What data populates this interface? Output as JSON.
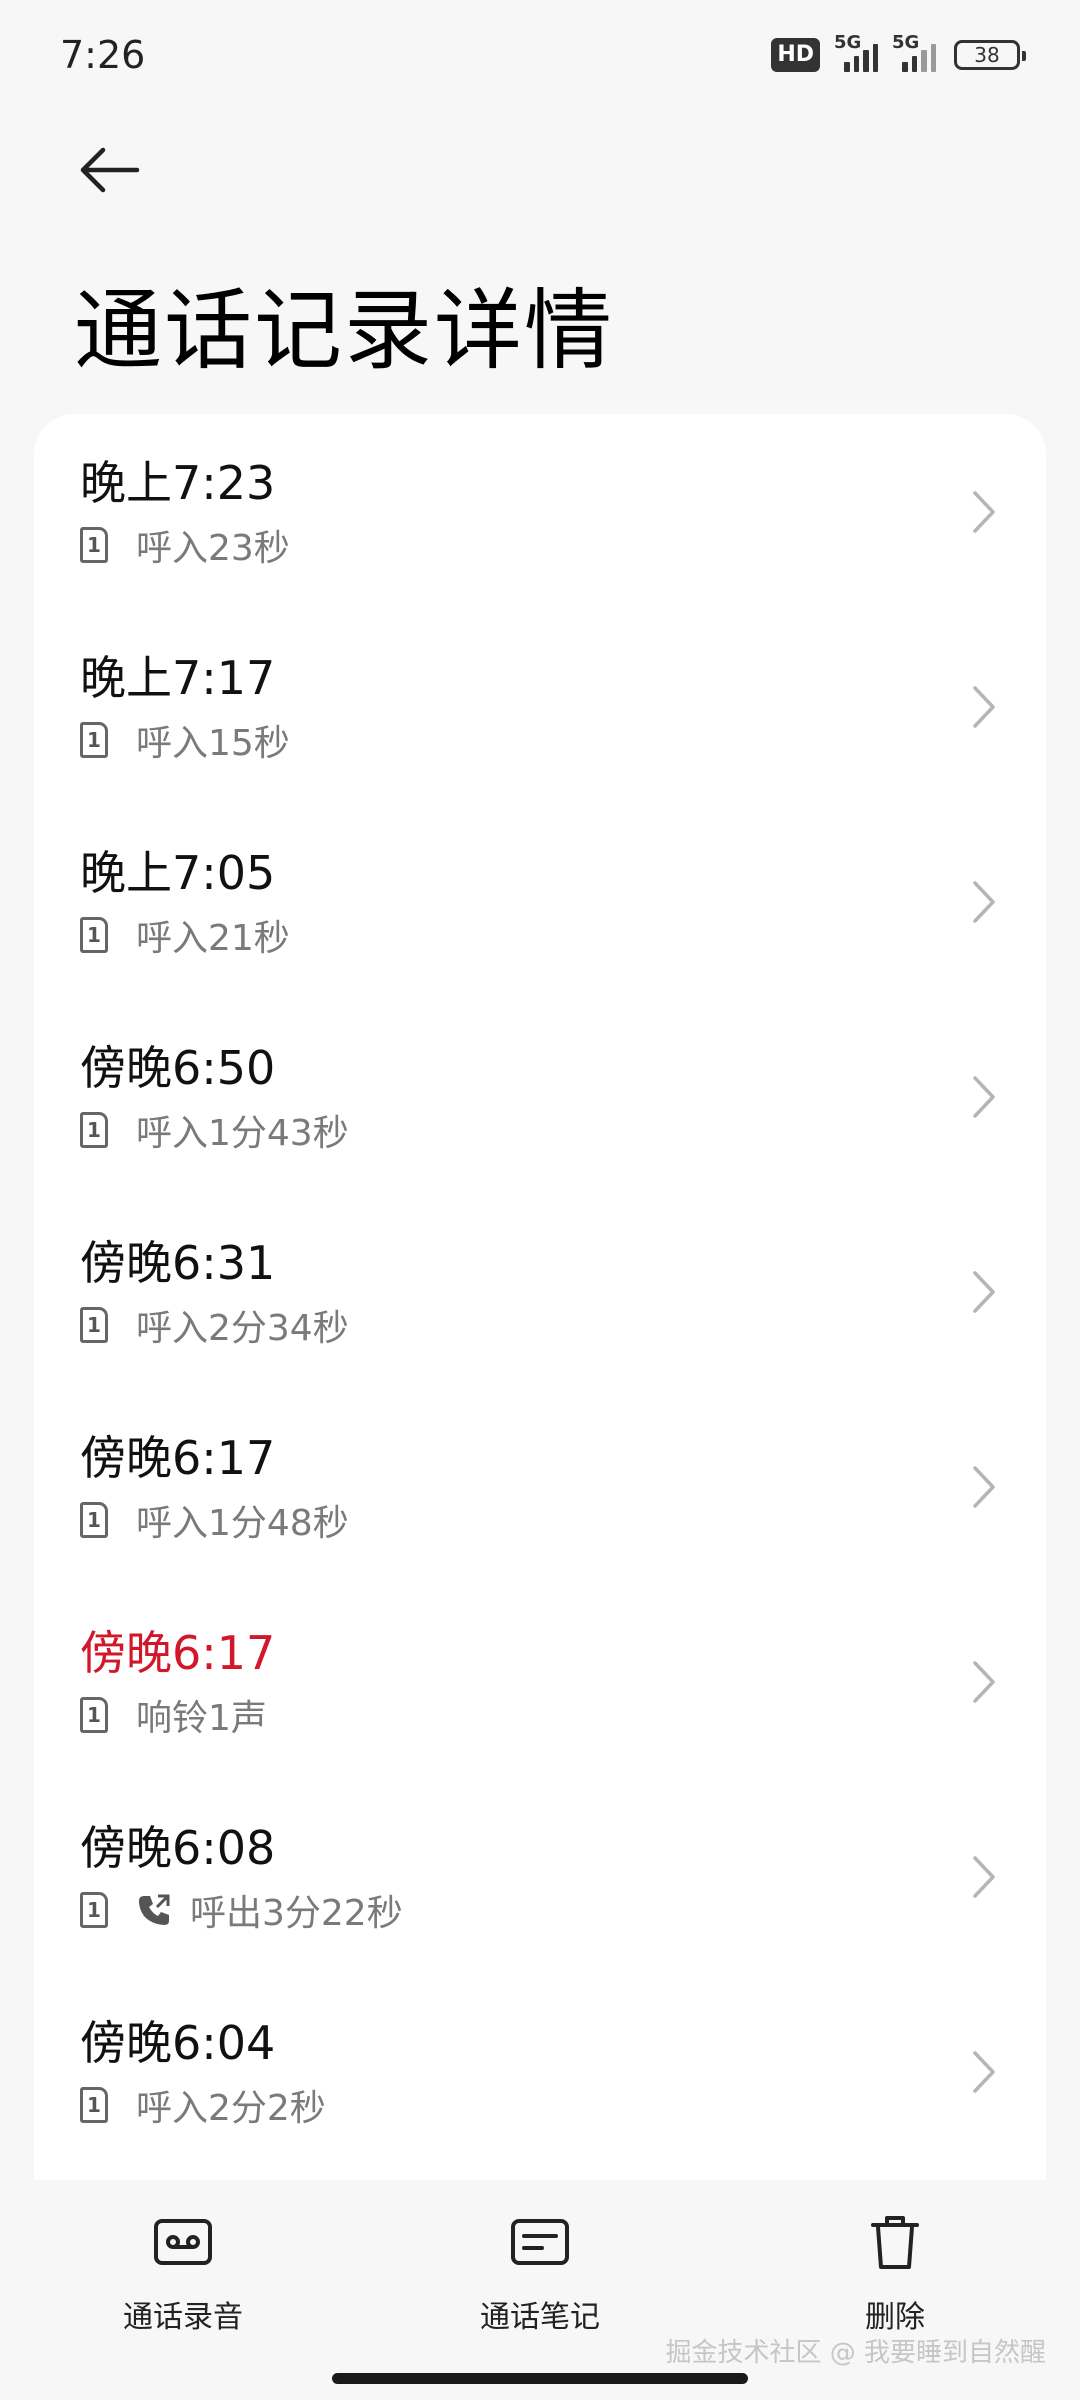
{
  "status_bar": {
    "time": "7:26",
    "hd_label": "HD",
    "network_1": "5G",
    "network_2": "5G",
    "battery": "38"
  },
  "header": {
    "title": "通话记录详情"
  },
  "calls": [
    {
      "time": "晚上7:23",
      "sim": "1",
      "desc": "呼入23秒",
      "missed": false,
      "outgoing": false
    },
    {
      "time": "晚上7:17",
      "sim": "1",
      "desc": "呼入15秒",
      "missed": false,
      "outgoing": false
    },
    {
      "time": "晚上7:05",
      "sim": "1",
      "desc": "呼入21秒",
      "missed": false,
      "outgoing": false
    },
    {
      "time": "傍晚6:50",
      "sim": "1",
      "desc": "呼入1分43秒",
      "missed": false,
      "outgoing": false
    },
    {
      "time": "傍晚6:31",
      "sim": "1",
      "desc": "呼入2分34秒",
      "missed": false,
      "outgoing": false
    },
    {
      "time": "傍晚6:17",
      "sim": "1",
      "desc": "呼入1分48秒",
      "missed": false,
      "outgoing": false
    },
    {
      "time": "傍晚6:17",
      "sim": "1",
      "desc": "响铃1声",
      "missed": true,
      "outgoing": false
    },
    {
      "time": "傍晚6:08",
      "sim": "1",
      "desc": "呼出3分22秒",
      "missed": false,
      "outgoing": true
    },
    {
      "time": "傍晚6:04",
      "sim": "1",
      "desc": "呼入2分2秒",
      "missed": false,
      "outgoing": false
    }
  ],
  "bottom_tabs": {
    "recording": "通话录音",
    "notes": "通话笔记",
    "delete": "删除"
  },
  "watermark": "掘金技术社区 @ 我要睡到自然醒",
  "colors": {
    "missed": "#d3172a",
    "background": "#f7f7f7",
    "card": "#ffffff"
  }
}
